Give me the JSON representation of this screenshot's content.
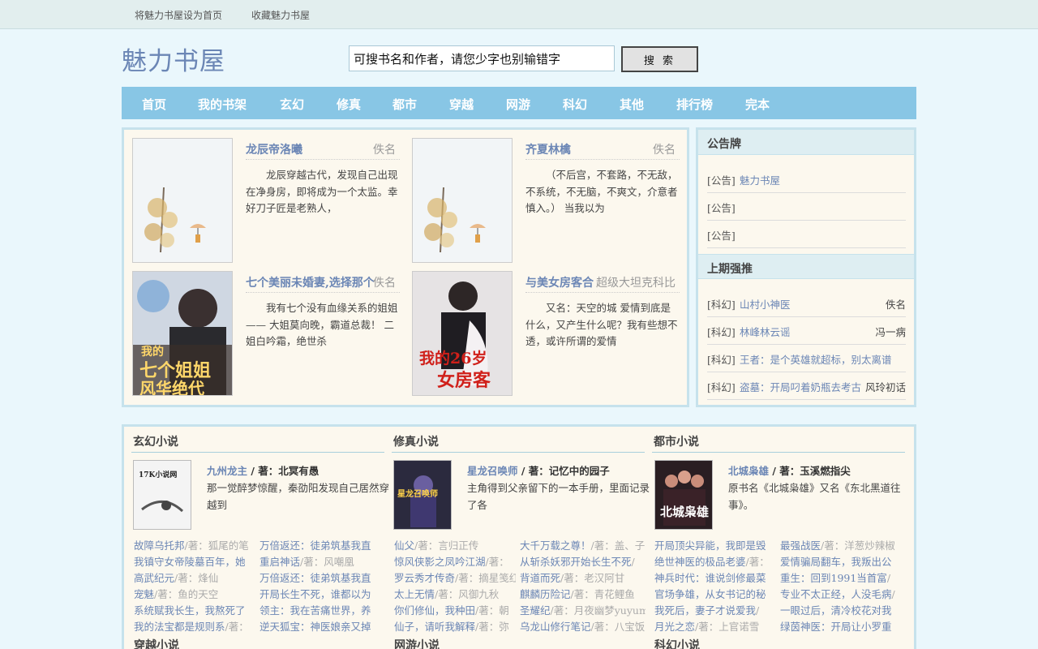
{
  "topbar": {
    "set_home": "将魅力书屋设为首页",
    "bookmark": "收藏魅力书屋"
  },
  "site": {
    "logo": "魅力书屋"
  },
  "search": {
    "value": "可搜书名和作者，请您少字也别输错字",
    "button": "搜 索"
  },
  "nav": [
    "首页",
    "我的书架",
    "玄幻",
    "修真",
    "都市",
    "穿越",
    "网游",
    "科幻",
    "其他",
    "排行榜",
    "完本"
  ],
  "featured": [
    {
      "title": "龙辰帝洛曦",
      "author": "佚名",
      "desc": "龙辰穿越古代，发现自己出现在净身房，即将成为一个太监。幸好刀子匠是老熟人，",
      "cover_icon": "umbrella-tree-cover"
    },
    {
      "title": "齐夏林檎",
      "author": "佚名",
      "desc": "（不后宫，不套路，不无敌，不系统，不无脑，不爽文，介意者慎入。） 当我以为",
      "cover_icon": "umbrella-tree-cover"
    },
    {
      "title": "七个美丽未婚妻,选择那个",
      "author": "佚名",
      "desc": "我有七个没有血缘关系的姐姐—— 大姐莫向晚，霸道总裁！ 二姐白吟霜，绝世杀",
      "cover_text": [
        "我的",
        "七个姐姐",
        "风华绝代"
      ]
    },
    {
      "title": "与美女房客合",
      "author": "超级大坦克科比",
      "desc": "又名：天空的城 爱情到底是什么，又产生How呢？我有些想不透，或许所谓的爱情",
      "cover_text": [
        "我的26岁",
        "女房客"
      ]
    }
  ],
  "notice": {
    "title": "公告牌",
    "items": [
      {
        "tag": "[公告]",
        "link": "魅力书屋"
      },
      {
        "tag": "[公告]",
        "link": ""
      },
      {
        "tag": "[公告]",
        "link": ""
      }
    ]
  },
  "recommend": {
    "title": "上期强推",
    "items": [
      {
        "tag": "[科幻]",
        "link": "山村小神医",
        "author": "佚名"
      },
      {
        "tag": "[科幻]",
        "link": "林峰林云谣",
        "author": "冯一病"
      },
      {
        "tag": "[科幻]",
        "link": "王者：是个英雄就超标，别太离谱",
        "author": ""
      },
      {
        "tag": "[科幻]",
        "link": "盗墓：开局叼着奶瓶去考古",
        "author": "风玲初话"
      }
    ]
  },
  "categories": [
    {
      "title": "玄幻小说",
      "top": {
        "title": "九州龙主",
        "author": " / 著：北冥有愚",
        "desc": "那一觉醉梦惊醒，秦劭阳发现自己居然穿越到"
      },
      "cover_text": "17K小说网",
      "list": [
        [
          {
            "t": "故障乌托邦",
            "a": "/著：狐尾的笔"
          },
          {
            "t": "万倍返还：徒弟筑基我直",
            "a": ""
          }
        ],
        [
          {
            "t": "我镇守女帝陵墓百年，她",
            "a": ""
          },
          {
            "t": "重启神话",
            "a": "/著：风嘲凰"
          }
        ],
        [
          {
            "t": "高武纪元",
            "a": "/著：烽仙"
          },
          {
            "t": "万倍返还：徒弟筑基我直",
            "a": ""
          }
        ],
        [
          {
            "t": "宠魅",
            "a": "/著：鱼的天空"
          },
          {
            "t": "开局长生不死，谁都以为",
            "a": ""
          }
        ],
        [
          {
            "t": "系统赋我长生，我熬死了",
            "a": ""
          },
          {
            "t": "领主：我在苦痛世界，养",
            "a": ""
          }
        ],
        [
          {
            "t": "我的法宝都是规则系",
            "a": "/著："
          },
          {
            "t": "逆天狐宝：神医娘亲又掉",
            "a": ""
          }
        ]
      ],
      "next": "穿越小说"
    },
    {
      "title": "修真小说",
      "top": {
        "title": "星龙召唤师",
        "author": " / 著：记忆中的园子",
        "desc": "主角得到父亲留下的一本手册，里面记录了各"
      },
      "cover_text": "星龙召唤师",
      "list": [
        [
          {
            "t": "仙父",
            "a": "/著：言归正传"
          },
          {
            "t": "大千万载之尊！",
            "a": "/著：盖、子"
          }
        ],
        [
          {
            "t": "惊风侠影之凤吟江湖",
            "a": "/著："
          },
          {
            "t": "从斩杀妖邪开始长生不死",
            "a": "/"
          }
        ],
        [
          {
            "t": "罗云秀才传奇",
            "a": "/著：摘星笺红"
          },
          {
            "t": "背道而死",
            "a": "/著：老汉阿甘"
          }
        ],
        [
          {
            "t": "太上无情",
            "a": "/著：风御九秋"
          },
          {
            "t": "麒麟历险记",
            "a": "/著：青花鲤鱼"
          }
        ],
        [
          {
            "t": "你们修仙，我种田",
            "a": "/著：朝"
          },
          {
            "t": "圣耀纪",
            "a": "/著：月夜幽梦yuyume"
          }
        ],
        [
          {
            "t": "仙子，请听我解释",
            "a": "/著：弥"
          },
          {
            "t": "乌龙山修行笔记",
            "a": "/著：八宝饭"
          }
        ]
      ],
      "next": "网游小说"
    },
    {
      "title": "都市小说",
      "top": {
        "title": "北城枭雄",
        "author": " / 著：玉溪燃指尖",
        "desc": "原书名《北城枭雄》又名《东北黑道往事》。"
      },
      "cover_text": "北城枭雄",
      "list": [
        [
          {
            "t": "开局顶尖异能，我即是毁",
            "a": ""
          },
          {
            "t": "最强战医",
            "a": "/著：洋葱炒辣椒"
          }
        ],
        [
          {
            "t": "绝世神医的极品老婆",
            "a": "/著："
          },
          {
            "t": "爱情骗局翻车，我叛出公",
            "a": ""
          }
        ],
        [
          {
            "t": "神兵时代：谁说剑修最菜",
            "a": ""
          },
          {
            "t": "重生：回到1991当首富",
            "a": "/"
          }
        ],
        [
          {
            "t": "官场争雄，从女书记的秘",
            "a": ""
          },
          {
            "t": "专业不太正经，人没毛病",
            "a": "/"
          }
        ],
        [
          {
            "t": "我死后，妻子才说爱我",
            "a": "/"
          },
          {
            "t": "一眼过后，清冷校花对我",
            "a": ""
          }
        ],
        [
          {
            "t": "月光之恋",
            "a": "/著：上官诺雪"
          },
          {
            "t": "绿茵神医：开局让小罗重",
            "a": ""
          }
        ]
      ],
      "next": "科幻小说"
    }
  ]
}
